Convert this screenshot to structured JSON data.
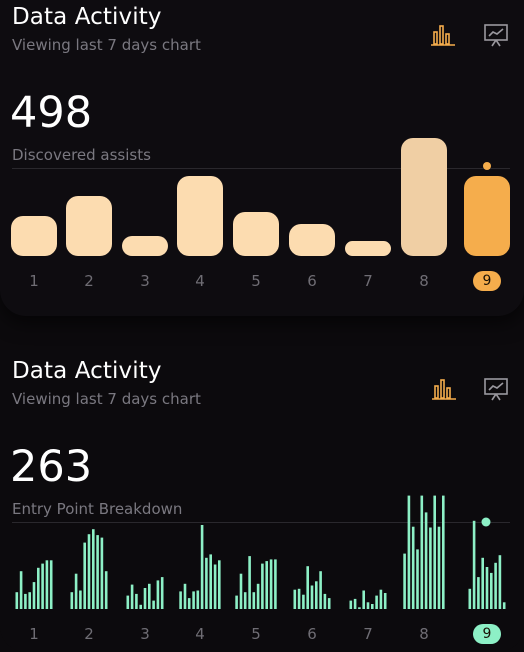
{
  "cards": [
    {
      "title": "Data Activity",
      "subtitle": "Viewing last 7 days chart",
      "value": "498",
      "value_label": "Discovered assists",
      "accent": "#f5ad4c",
      "bar_color": "#fcdcb0",
      "icons": [
        "bar-chart-icon",
        "presentation-board-icon"
      ],
      "chart_data": {
        "type": "bar",
        "categories": [
          "1",
          "2",
          "3",
          "4",
          "5",
          "6",
          "7",
          "8",
          "9"
        ],
        "values": [
          40,
          60,
          20,
          80,
          44,
          32,
          15,
          118,
          80
        ],
        "selected": "9",
        "ylim": [
          0,
          120
        ]
      }
    },
    {
      "title": "Data Activity",
      "subtitle": "Viewing last 7 days chart",
      "value": "263",
      "value_label": "Entry Point Breakdown",
      "accent": "#8df0c6",
      "bar_color": "#8df0c6",
      "icons": [
        "bar-chart-icon",
        "presentation-board-icon"
      ],
      "chart_data": {
        "type": "bar",
        "categories": [
          "1",
          "2",
          "3",
          "4",
          "5",
          "6",
          "7",
          "8",
          "9"
        ],
        "series": [
          [
            0.2,
            0.45,
            0.18,
            0.2,
            0.32,
            0.49,
            0.54,
            0.58,
            0.58
          ],
          [
            0.2,
            0.42,
            0.22,
            0.79,
            0.89,
            0.95,
            0.88,
            0.85,
            0.45
          ],
          [
            0.16,
            0.29,
            0.18,
            0.05,
            0.25,
            0.3,
            0.1,
            0.34,
            0.38
          ],
          [
            0.21,
            0.3,
            0.13,
            0.21,
            0.22,
            1.0,
            0.61,
            0.65,
            0.53,
            0.58
          ],
          [
            0.16,
            0.42,
            0.2,
            0.63,
            0.2,
            0.3,
            0.54,
            0.57,
            0.59,
            0.59
          ],
          [
            0.23,
            0.24,
            0.17,
            0.51,
            0.28,
            0.33,
            0.45,
            0.18,
            0.13
          ],
          [
            0.1,
            0.12,
            0.02,
            0.22,
            0.08,
            0.06,
            0.16,
            0.23,
            0.19
          ],
          [
            0.66,
            1.35,
            0.98,
            0.71,
            1.35,
            1.15,
            0.97,
            1.35,
            0.98,
            1.35
          ],
          [
            0.24,
            1.05,
            0.38,
            0.61,
            0.5,
            0.43,
            0.55,
            0.64,
            0.08
          ]
        ],
        "selected": "9",
        "ylim": [
          0,
          1.4
        ]
      }
    }
  ]
}
